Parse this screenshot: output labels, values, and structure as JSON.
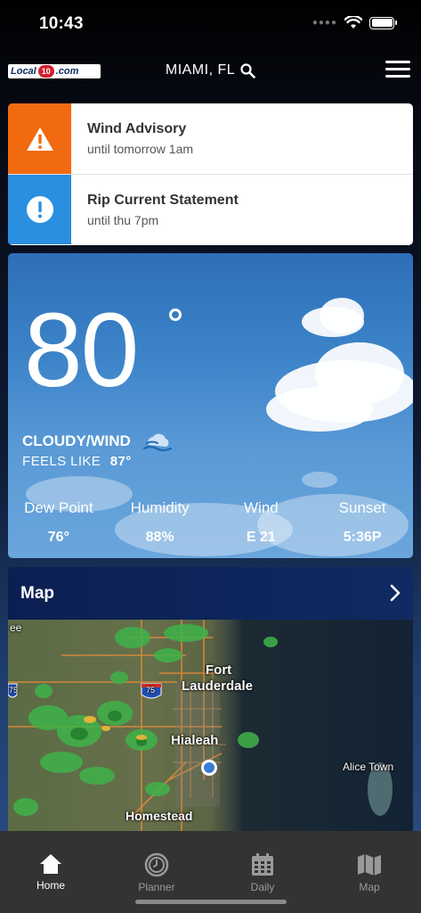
{
  "status_bar": {
    "time": "10:43"
  },
  "header": {
    "logo": {
      "name": "Local",
      "number": "10",
      "suffix": ".com"
    },
    "location": "MIAMI, FL"
  },
  "alerts": [
    {
      "title": "Wind Advisory",
      "subtitle": "until tomorrow 1am",
      "color": "#f26a10",
      "icon": "warning-triangle-icon"
    },
    {
      "title": "Rip Current Statement",
      "subtitle": "until thu 7pm",
      "color": "#2a8fe0",
      "icon": "info-exclamation-icon"
    }
  ],
  "weather": {
    "temperature": "80",
    "condition": "CLOUDY/WIND",
    "feels_like_label": "FEELS LIKE",
    "feels_like_value": "87°",
    "stats": [
      {
        "label": "Dew Point",
        "value": "76°"
      },
      {
        "label": "Humidity",
        "value": "88%"
      },
      {
        "label": "Wind",
        "value": "E 21"
      },
      {
        "label": "Sunset",
        "value": "5:36P"
      }
    ]
  },
  "map": {
    "title": "Map",
    "labels": {
      "fort": "Fort",
      "lauderdale": "Lauderdale",
      "hialeah": "Hialeah",
      "homestead": "Homestead",
      "alice_town": "Alice Town",
      "interstate": "75",
      "interstate_left": "75",
      "partial": "ee"
    }
  },
  "tabs": [
    {
      "label": "Home",
      "active": true
    },
    {
      "label": "Planner",
      "active": false
    },
    {
      "label": "Daily",
      "active": false
    },
    {
      "label": "Map",
      "active": false
    }
  ]
}
